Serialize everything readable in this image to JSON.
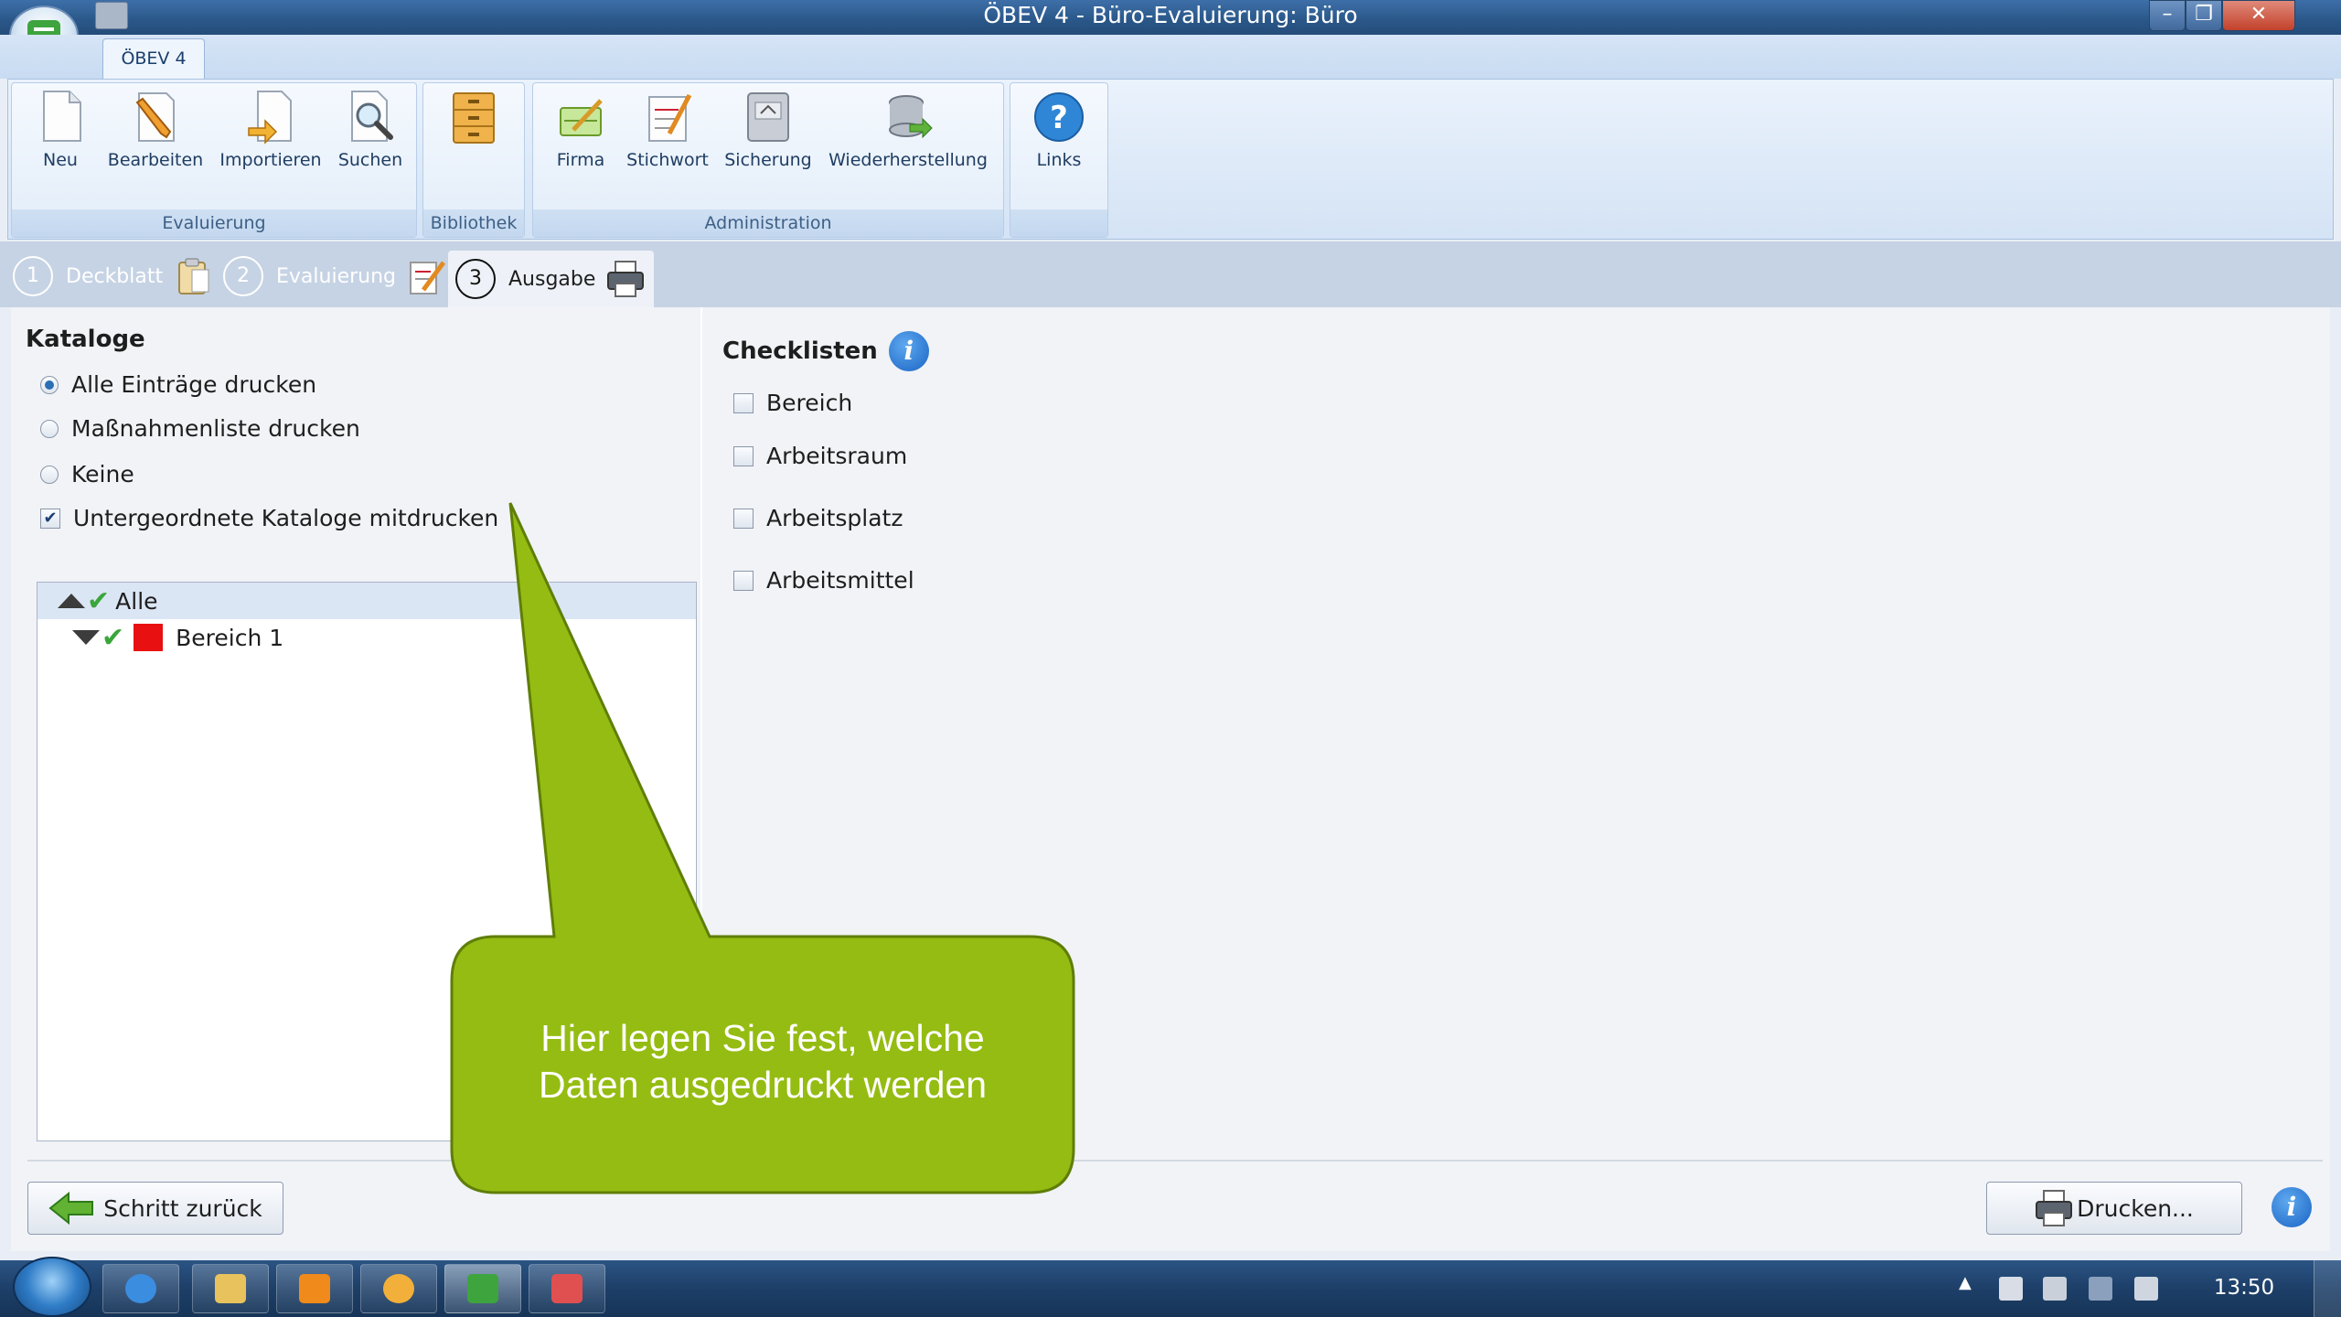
{
  "window": {
    "title": "ÖBEV 4 - Büro-Evaluierung: Büro",
    "minimize_glyph": "–",
    "restore_glyph": "❐",
    "close_glyph": "✕"
  },
  "ribbon": {
    "tab": "ÖBEV 4",
    "groups": [
      {
        "label": "Evaluierung",
        "buttons": [
          {
            "label": "Neu",
            "icon": "new-document-icon"
          },
          {
            "label": "Bearbeiten",
            "icon": "edit-pencil-icon"
          },
          {
            "label": "Importieren",
            "icon": "import-icon"
          },
          {
            "label": "Suchen",
            "icon": "search-icon"
          }
        ]
      },
      {
        "label": "Bibliothek",
        "buttons": [
          {
            "label": "",
            "icon": "cabinet-icon"
          }
        ]
      },
      {
        "label": "Administration",
        "buttons": [
          {
            "label": "Firma",
            "icon": "company-icon"
          },
          {
            "label": "Stichwort",
            "icon": "keyword-icon"
          },
          {
            "label": "Sicherung",
            "icon": "backup-icon"
          },
          {
            "label": "Wiederherstellung",
            "icon": "restore-icon"
          }
        ]
      },
      {
        "label": "",
        "buttons": [
          {
            "label": "Links",
            "icon": "help-icon"
          }
        ]
      }
    ]
  },
  "steps": [
    {
      "num": "1",
      "label": "Deckblatt",
      "active": false
    },
    {
      "num": "2",
      "label": "Evaluierung",
      "active": false
    },
    {
      "num": "3",
      "label": "Ausgabe",
      "active": true
    }
  ],
  "kataloge": {
    "heading": "Kataloge",
    "options": [
      {
        "label": "Alle Einträge drucken",
        "selected": true
      },
      {
        "label": "Maßnahmenliste drucken",
        "selected": false
      },
      {
        "label": "Keine",
        "selected": false
      }
    ],
    "sub_checkbox": {
      "label": "Untergeordnete Kataloge mitdrucken",
      "checked": true
    },
    "tree": [
      {
        "label": "Alle",
        "expanded": true
      },
      {
        "label": "Bereich 1",
        "expanded": true,
        "color": "#e81010"
      }
    ]
  },
  "checklisten": {
    "heading": "Checklisten",
    "items": [
      {
        "label": "Bereich",
        "checked": false
      },
      {
        "label": "Arbeitsraum",
        "checked": false
      },
      {
        "label": "Arbeitsplatz",
        "checked": false
      },
      {
        "label": "Arbeitsmittel",
        "checked": false
      }
    ]
  },
  "buttons": {
    "back": "Schritt zurück",
    "print": "Drucken..."
  },
  "callout": {
    "line1": "Hier legen Sie fest, welche",
    "line2": "Daten ausgedruckt werden",
    "color": "#95bc12"
  },
  "taskbar": {
    "clock": "13:50",
    "tray_arrow": "▲"
  },
  "colors": {
    "accent": "#2b5b8e",
    "tree_selection": "#dbe6f5",
    "callout": "#95bc12",
    "check": "#3aa63a"
  }
}
